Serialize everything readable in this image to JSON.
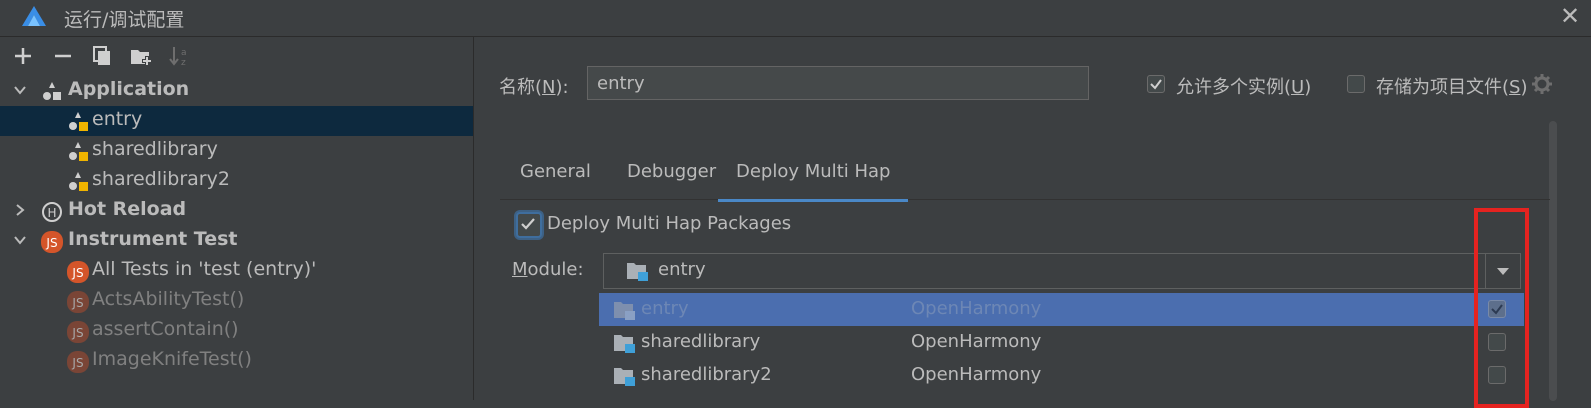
{
  "window": {
    "title": "运行/调试配置"
  },
  "colors": {
    "highlight": "#e52320",
    "accent": "#4a88c7",
    "selection": "#4b6eaf"
  },
  "toolbar": {
    "icons": [
      "add-icon",
      "remove-icon",
      "copy-icon",
      "new-folder-icon",
      "sort-icon"
    ]
  },
  "tree": {
    "application": {
      "label": "Application"
    },
    "entry": {
      "label": "entry"
    },
    "sharedlibrary": {
      "label": "sharedlibrary"
    },
    "sharedlibrary2": {
      "label": "sharedlibrary2"
    },
    "hot_reload": {
      "label": "Hot Reload"
    },
    "instrument_test": {
      "label": "Instrument Test"
    },
    "all_tests": {
      "label": "All Tests in 'test (entry)'"
    },
    "acts": {
      "label": "ActsAbilityTest()"
    },
    "assert": {
      "label": "assertContain()"
    },
    "imageknife": {
      "label": "ImageKnifeTest()"
    }
  },
  "form": {
    "name_label": "名称(",
    "name_key": "N",
    "name_label_end": "):",
    "name_value": "entry",
    "allow_multi": {
      "label": "允许多个实例(",
      "key": "U",
      "end": ")",
      "checked": true
    },
    "store_as_file": {
      "label": "存储为项目文件(",
      "key": "S",
      "end": ")",
      "checked": false
    }
  },
  "tabs": [
    {
      "label": "General",
      "active": false
    },
    {
      "label": "Debugger",
      "active": false
    },
    {
      "label": "Deploy Multi Hap",
      "active": true
    }
  ],
  "deploy": {
    "label": "Deploy Multi Hap Packages",
    "checked": true
  },
  "module": {
    "label_key": "M",
    "label_rest": "odule:",
    "value": "entry"
  },
  "dropdown": {
    "rows": [
      {
        "name": "entry",
        "type": "OpenHarmony",
        "checked": true,
        "selected": true
      },
      {
        "name": "sharedlibrary",
        "type": "OpenHarmony",
        "checked": false,
        "selected": false
      },
      {
        "name": "sharedlibrary2",
        "type": "OpenHarmony",
        "checked": false,
        "selected": false
      }
    ]
  }
}
